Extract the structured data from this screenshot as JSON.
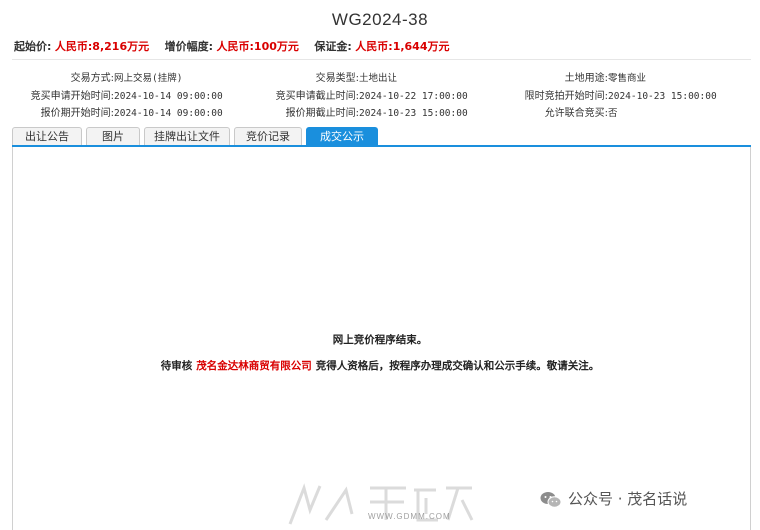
{
  "header": {
    "title": "WG2024-38",
    "prices": [
      {
        "label": "起始价:",
        "value": "人民币:8,216万元"
      },
      {
        "label": "增价幅度:",
        "value": "人民币:100万元"
      },
      {
        "label": "保证金:",
        "value": "人民币:1,644万元"
      }
    ]
  },
  "info": {
    "rows": [
      [
        {
          "label": "交易方式:",
          "value": "网上交易(挂牌)"
        },
        {
          "label": "交易类型:",
          "value": "土地出让"
        },
        {
          "label": "土地用途:",
          "value": "零售商业"
        }
      ],
      [
        {
          "label": "竞买申请开始时间:",
          "value": "2024-10-14 09:00:00"
        },
        {
          "label": "竞买申请截止时间:",
          "value": "2024-10-22 17:00:00"
        },
        {
          "label": "限时竞拍开始时间:",
          "value": "2024-10-23 15:00:00"
        }
      ],
      [
        {
          "label": "报价期开始时间:",
          "value": "2024-10-14 09:00:00"
        },
        {
          "label": "报价期截止时间:",
          "value": "2024-10-23 15:00:00"
        },
        {
          "label": "允许联合竞买:",
          "value": "否"
        }
      ]
    ]
  },
  "tabs": [
    {
      "label": "出让公告",
      "active": false
    },
    {
      "label": "图片",
      "active": false
    },
    {
      "label": "挂牌出让文件",
      "active": false
    },
    {
      "label": "竞价记录",
      "active": false
    },
    {
      "label": "成交公示",
      "active": true
    }
  ],
  "result": {
    "line1": "网上竞价程序结束。",
    "line2_prefix": "待审核",
    "company": "茂名金达林商贸有限公司",
    "line2_suffix": "竞得人资格后，按程序办理成交确认和公示手续。敬请关注。"
  },
  "watermark": {
    "site_url": "WWW.GDMM.COM",
    "wechat_label": "公众号 · 茂名话说",
    "icon": "wechat-icon"
  },
  "colors": {
    "accent": "#1a8fdd",
    "price_red": "#d90000"
  }
}
